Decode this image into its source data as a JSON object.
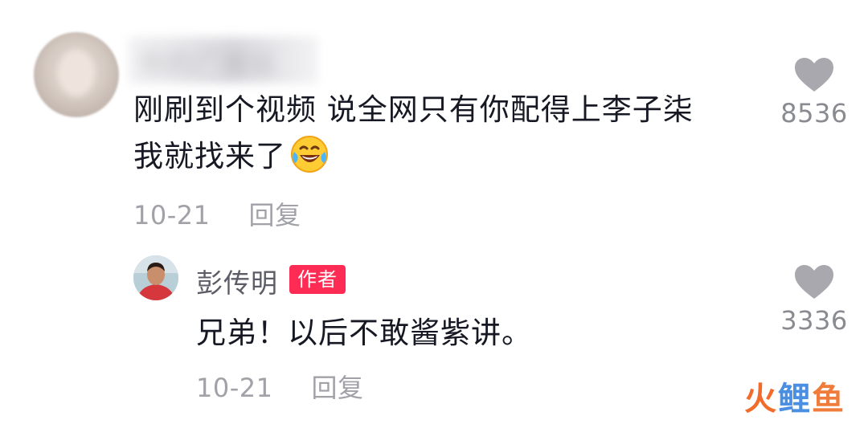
{
  "main_comment": {
    "username": "你的广播站",
    "text_line1": "刚刷到个视频 说全网只有你配得上李子柒",
    "text_line2": "我就找来了",
    "date": "10-21",
    "reply_label": "回复",
    "likes": "8536",
    "emoji": "laughing-with-tears-emoji"
  },
  "reply_comment": {
    "username": "彭传明",
    "badge": "作者",
    "text": "兄弟！以后不敢酱紫讲。",
    "date": "10-21",
    "reply_label": "回复",
    "likes": "3336"
  },
  "watermark": {
    "part1": "火",
    "part2": "鲤",
    "part3": "鱼"
  },
  "colors": {
    "badge": "#fe2c55",
    "heart": "#a8a8ae",
    "meta_text": "#a1a1a8",
    "watermark_orange": "#f36b2a",
    "watermark_blue": "#4a8fe2"
  }
}
